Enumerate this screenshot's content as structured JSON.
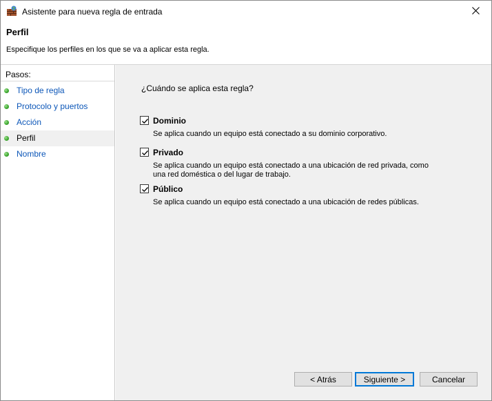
{
  "window": {
    "title": "Asistente para nueva regla de entrada",
    "app_icon": "firewall-icon",
    "close_icon": "close-icon"
  },
  "header": {
    "title": "Perfil",
    "description": "Especifique los perfiles en los que se va a aplicar esta regla."
  },
  "sidebar": {
    "heading": "Pasos:",
    "items": [
      {
        "label": "Tipo de regla"
      },
      {
        "label": "Protocolo y puertos"
      },
      {
        "label": "Acción"
      },
      {
        "label": "Perfil",
        "current": true
      },
      {
        "label": "Nombre"
      }
    ]
  },
  "main": {
    "question": "¿Cuándo se aplica esta regla?",
    "options": [
      {
        "label": "Dominio",
        "checked": true,
        "description": "Se aplica cuando un equipo está conectado a su dominio corporativo."
      },
      {
        "label": "Privado",
        "checked": true,
        "description": "Se aplica cuando un equipo está conectado a una ubicación de red privada, como una red doméstica o del lugar de trabajo."
      },
      {
        "label": "Público",
        "checked": true,
        "description": "Se aplica cuando un equipo está conectado a una ubicación de redes públicas."
      }
    ]
  },
  "buttons": {
    "back": "< Atrás",
    "next": "Siguiente >",
    "cancel": "Cancelar"
  },
  "colors": {
    "link": "#0b56b8",
    "step_dot": "#39a62c",
    "content_bg": "#f0f0f0",
    "focus_border": "#0078d7"
  }
}
